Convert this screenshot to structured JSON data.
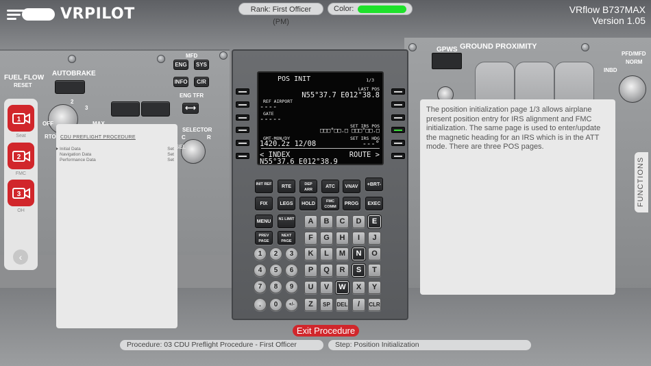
{
  "header": {
    "logo_text": "VRPILOT",
    "rank_label": "Rank: First Officer (PM)",
    "color_label": "Color:",
    "color_value": "#1ee12b",
    "app_name": "VRflow B737MAX",
    "version": "Version 1.05"
  },
  "left_panel": {
    "fuel_flow": "FUEL FLOW",
    "reset": "RESET",
    "autobrake": "AUTOBRAKE",
    "autobrake_off": "OFF",
    "autobrake_rto": "RTO",
    "autobrake_2": "2",
    "autobrake_3": "3",
    "autobrake_max": "MAX",
    "mfd": "MFD",
    "eng": "ENG",
    "sys": "SYS",
    "info": "INFO",
    "cr": "C/R",
    "eng_tfr": "ENG TFR",
    "selector": "SELECTOR",
    "sel_c": "C",
    "sel_r": "R",
    "sel_knob": "SEL"
  },
  "sidebar": {
    "items": [
      {
        "number": "1",
        "label": "Seat"
      },
      {
        "number": "2",
        "label": "FMC"
      },
      {
        "number": "3",
        "label": "OH"
      }
    ],
    "back_icon": "chevron-left-icon"
  },
  "procedure_card": {
    "title": "CDU PREFLIGHT PROCEDURE",
    "rows": [
      {
        "name": "Initial Data",
        "state": "Set"
      },
      {
        "name": "Navigation Data",
        "state": "Set"
      },
      {
        "name": "Performance Data",
        "state": "Set"
      }
    ]
  },
  "cdu_screen": {
    "title": "POS INIT",
    "page": "1/3",
    "last_pos_label": "LAST POS",
    "last_pos_value": "N55°37.7 E012°38.8",
    "ref_airport_label": "REF AIRPORT",
    "ref_airport_value": "----",
    "gate_label": "GATE",
    "gate_value": "-----",
    "set_irs_pos_label": "SET IRS POS",
    "set_irs_pos_value": "□□□°□□.□ □□□°□□.□",
    "gmt_label": "GMT-MON/DY",
    "gmt_value": "1420.2z 12/08",
    "set_irs_hdg_label": "SET IRS HDG",
    "set_irs_hdg_value": "---°",
    "index_label": "< INDEX",
    "route_label": "ROUTE >",
    "scratchpad": "N55°37.6 E012°38.9"
  },
  "cdu_keys": {
    "row1": [
      "INIT REF",
      "RTE",
      "DEP ARR",
      "ATC",
      "VNAV",
      "+BRT-"
    ],
    "row2": [
      "FIX",
      "LEGS",
      "HOLD",
      "FMC COMM",
      "PROG",
      "EXEC"
    ],
    "menu": "MENU",
    "n1_limit": "N1 LIMIT",
    "prev_page": "PREV PAGE",
    "next_page": "NEXT PAGE",
    "alpha": [
      "A",
      "B",
      "C",
      "D",
      "E",
      "F",
      "G",
      "H",
      "I",
      "J",
      "K",
      "L",
      "M",
      "N",
      "O",
      "P",
      "Q",
      "R",
      "S",
      "T",
      "U",
      "V",
      "W",
      "X",
      "Y",
      "Z",
      "SP",
      "DEL",
      "/",
      "CLR"
    ],
    "nums": [
      "1",
      "2",
      "3",
      "4",
      "5",
      "6",
      "7",
      "8",
      "9",
      ".",
      "0",
      "+/-"
    ]
  },
  "right_panel": {
    "gpws": "GPWS",
    "ground_proximity": "GROUND PROXIMITY",
    "pfd_mfd": "PFD/MFD",
    "norm": "NORM",
    "inbd": "INBD"
  },
  "info_card": {
    "text": "The position initialization page 1/3 allows airplane present position entry for IRS alignment and FMC initialization. The same page is used to enter/update the magnetic heading for an IRS which is in the ATT mode. There are three POS pages."
  },
  "functions_tab": "FUNCTIONS",
  "footer": {
    "exit_label": "Exit Procedure",
    "procedure": "Procedure: 03 CDU Preflight Procedure - First Officer",
    "step": "Step: Position Initialization"
  }
}
